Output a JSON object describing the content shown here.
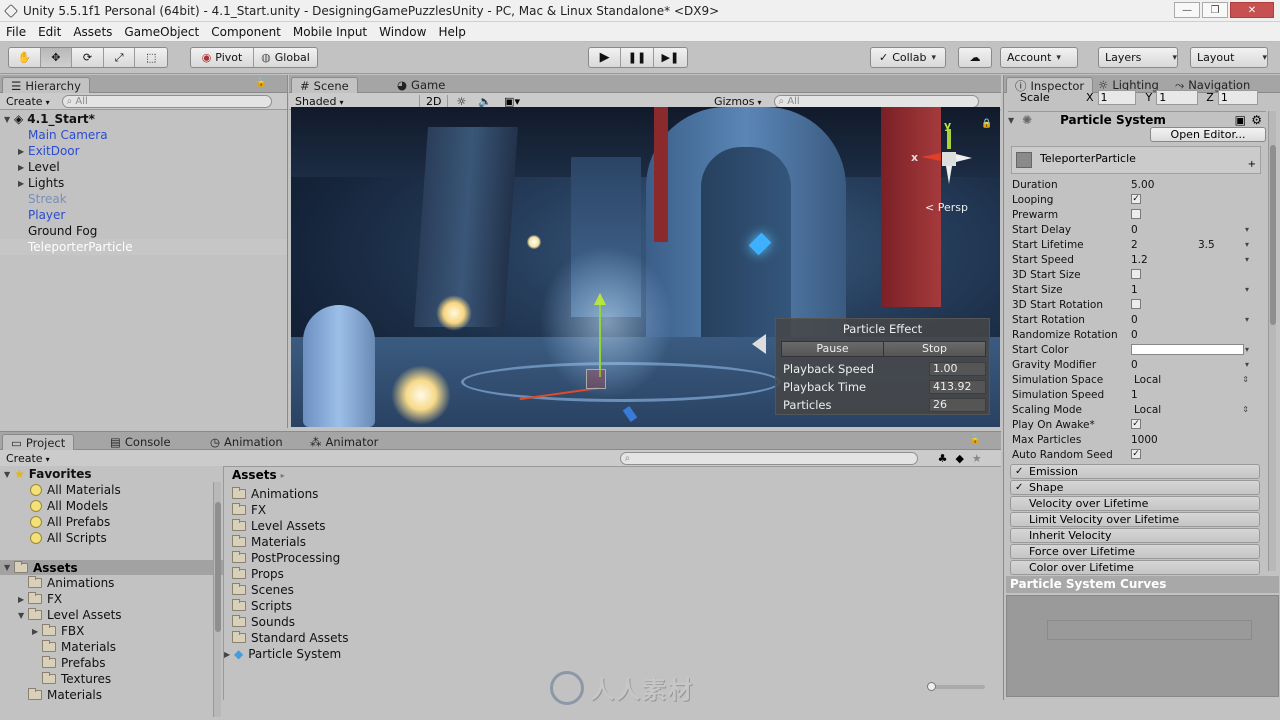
{
  "window": {
    "title": "Unity 5.5.1f1 Personal (64bit) - 4.1_Start.unity - DesigningGamePuzzlesUnity - PC, Mac & Linux Standalone* <DX9>"
  },
  "menu": [
    "File",
    "Edit",
    "Assets",
    "GameObject",
    "Component",
    "Mobile Input",
    "Window",
    "Help"
  ],
  "toolbar": {
    "pivot": "Pivot",
    "global": "Global",
    "collab": "Collab",
    "account": "Account",
    "layers": "Layers",
    "layout": "Layout"
  },
  "hierarchy": {
    "tab": "Hierarchy",
    "create": "Create",
    "search_placeholder": "All",
    "root": "4.1_Start*",
    "items": [
      {
        "label": "Main Camera",
        "color": "#2a4cd0",
        "arrow": ""
      },
      {
        "label": "ExitDoor",
        "color": "#2a4cd0",
        "arrow": "▶"
      },
      {
        "label": "Level",
        "color": "#111111",
        "arrow": "▶"
      },
      {
        "label": "Lights",
        "color": "#111111",
        "arrow": "▶"
      },
      {
        "label": "Streak",
        "color": "#7a8fb8",
        "arrow": ""
      },
      {
        "label": "Player",
        "color": "#2a4cd0",
        "arrow": ""
      },
      {
        "label": "Ground Fog",
        "color": "#111111",
        "arrow": ""
      },
      {
        "label": "TeleporterParticle",
        "color": "#ffffff",
        "arrow": ""
      }
    ]
  },
  "scene": {
    "tab_scene": "Scene",
    "tab_game": "Game",
    "shading": "Shaded",
    "mode2d": "2D",
    "gizmos": "Gizmos",
    "search_placeholder": "All",
    "persp": "< Persp",
    "gizmo_x": "x",
    "gizmo_y": "y"
  },
  "particle_effect": {
    "title": "Particle Effect",
    "pause": "Pause",
    "stop": "Stop",
    "rows": [
      {
        "label": "Playback Speed",
        "value": "1.00"
      },
      {
        "label": "Playback Time",
        "value": "413.92"
      },
      {
        "label": "Particles",
        "value": "26"
      }
    ]
  },
  "project": {
    "tab_project": "Project",
    "tab_console": "Console",
    "tab_animation": "Animation",
    "tab_animator": "Animator",
    "create": "Create",
    "favorites_label": "Favorites",
    "favorites": [
      "All Materials",
      "All Models",
      "All Prefabs",
      "All Scripts"
    ],
    "assets_label": "Assets",
    "tree": [
      {
        "label": "Animations",
        "indent": 1,
        "arrow": ""
      },
      {
        "label": "FX",
        "indent": 1,
        "arrow": "▶"
      },
      {
        "label": "Level Assets",
        "indent": 1,
        "arrow": "▼"
      },
      {
        "label": "FBX",
        "indent": 2,
        "arrow": "▶"
      },
      {
        "label": "Materials",
        "indent": 2,
        "arrow": ""
      },
      {
        "label": "Prefabs",
        "indent": 2,
        "arrow": ""
      },
      {
        "label": "Textures",
        "indent": 2,
        "arrow": ""
      },
      {
        "label": "Materials",
        "indent": 1,
        "arrow": ""
      }
    ],
    "breadcrumb": "Assets",
    "files": [
      "Animations",
      "FX",
      "Level Assets",
      "Materials",
      "PostProcessing",
      "Props",
      "Scenes",
      "Scripts",
      "Sounds",
      "Standard Assets",
      "Particle System"
    ]
  },
  "inspector": {
    "tab_inspector": "Inspector",
    "tab_lighting": "Lighting",
    "tab_navigation": "Navigation",
    "scale_label": "Scale",
    "scale": {
      "x": "1",
      "y": "1",
      "z": "1"
    },
    "component_title": "Particle System",
    "open_editor": "Open Editor...",
    "module_name": "TeleporterParticle",
    "fields": [
      {
        "label": "Duration",
        "value": "5.00",
        "type": "text"
      },
      {
        "label": "Looping",
        "value": "✓",
        "type": "check"
      },
      {
        "label": "Prewarm",
        "value": "",
        "type": "check"
      },
      {
        "label": "Start Delay",
        "value": "0",
        "type": "dd"
      },
      {
        "label": "Start Lifetime",
        "value": "2",
        "value2": "3.5",
        "type": "dd"
      },
      {
        "label": "Start Speed",
        "value": "1.2",
        "type": "dd"
      },
      {
        "label": "3D Start Size",
        "value": "",
        "type": "check"
      },
      {
        "label": "Start Size",
        "value": "1",
        "type": "dd"
      },
      {
        "label": "3D Start Rotation",
        "value": "",
        "type": "check"
      },
      {
        "label": "Start Rotation",
        "value": "0",
        "type": "dd"
      },
      {
        "label": "Randomize Rotation",
        "value": "0",
        "type": "text"
      },
      {
        "label": "Start Color",
        "value": "",
        "type": "color"
      },
      {
        "label": "Gravity Modifier",
        "value": "0",
        "type": "dd"
      },
      {
        "label": "Simulation Space",
        "value": "Local",
        "type": "select"
      },
      {
        "label": "Simulation Speed",
        "value": "1",
        "type": "text"
      },
      {
        "label": "Scaling Mode",
        "value": "Local",
        "type": "select"
      },
      {
        "label": "Play On Awake*",
        "value": "✓",
        "type": "check"
      },
      {
        "label": "Max Particles",
        "value": "1000",
        "type": "text"
      },
      {
        "label": "Auto Random Seed",
        "value": "✓",
        "type": "check"
      }
    ],
    "modules": [
      {
        "label": "Emission",
        "checked": true
      },
      {
        "label": "Shape",
        "checked": true
      },
      {
        "label": "Velocity over Lifetime",
        "checked": false
      },
      {
        "label": "Limit Velocity over Lifetime",
        "checked": false
      },
      {
        "label": "Inherit Velocity",
        "checked": false
      },
      {
        "label": "Force over Lifetime",
        "checked": false
      },
      {
        "label": "Color over Lifetime",
        "checked": false
      }
    ],
    "curves_title": "Particle System Curves"
  },
  "watermark": "人人素材"
}
